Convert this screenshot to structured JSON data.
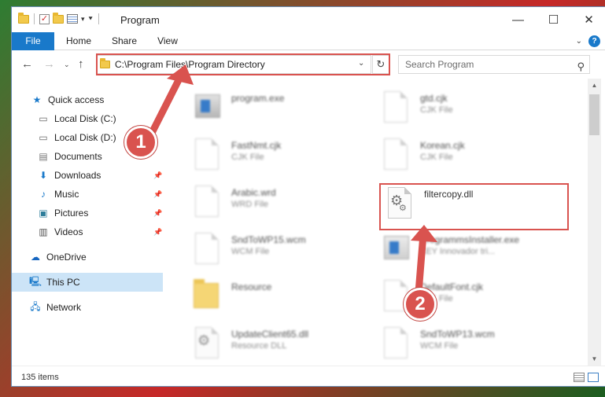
{
  "window": {
    "title": "Program",
    "controls": {
      "minimize": "—",
      "maximize": "☐",
      "close": "✕"
    }
  },
  "ribbon": {
    "tabs": [
      "File",
      "Home",
      "Share",
      "View"
    ]
  },
  "address_bar": {
    "path": "C:\\Program Files\\Program Directory",
    "dropdown_icon": "chevron-down-icon",
    "refresh_icon": "refresh-icon"
  },
  "search": {
    "placeholder": "Search Program",
    "icon": "search-icon"
  },
  "sidebar": {
    "items": [
      {
        "label": "Quick access",
        "icon": "star-icon"
      },
      {
        "label": "Local Disk (C:)",
        "icon": "drive-icon"
      },
      {
        "label": "Local Disk (D:)",
        "icon": "drive-icon"
      },
      {
        "label": "Documents",
        "icon": "documents-icon"
      },
      {
        "label": "Downloads",
        "icon": "download-icon"
      },
      {
        "label": "Music",
        "icon": "music-icon"
      },
      {
        "label": "Pictures",
        "icon": "pictures-icon"
      },
      {
        "label": "Videos",
        "icon": "videos-icon"
      },
      {
        "label": "OneDrive",
        "icon": "cloud-icon"
      },
      {
        "label": "This PC",
        "icon": "computer-icon"
      },
      {
        "label": "Network",
        "icon": "network-icon"
      }
    ]
  },
  "files": [
    {
      "name": "program.exe",
      "type": ""
    },
    {
      "name": "gtd.cjk",
      "type": "CJK File"
    },
    {
      "name": "FastNmt.cjk",
      "type": "CJK File"
    },
    {
      "name": "Korean.cjk",
      "type": "CJK File"
    },
    {
      "name": "Arabic.wrd",
      "type": "WRD File"
    },
    {
      "name": "filtercopy.dll",
      "type": ""
    },
    {
      "name": "SndToWP15.wcm",
      "type": "WCM File"
    },
    {
      "name": "ProgrammsInstaller.exe",
      "type": "KEY Innovador tri..."
    },
    {
      "name": "Resource",
      "type": ""
    },
    {
      "name": "DefaultFont.cjk",
      "type": "CJK File"
    },
    {
      "name": "UpdateClient65.dll",
      "type": "Resource DLL"
    },
    {
      "name": "SndToWP13.wcm",
      "type": "WCM File"
    }
  ],
  "status": {
    "item_count": "135 items"
  },
  "annotations": {
    "step1": "1",
    "step2": "2"
  },
  "colors": {
    "accent": "#1979ca",
    "highlight": "#d9534f",
    "selected": "#cce4f7"
  }
}
